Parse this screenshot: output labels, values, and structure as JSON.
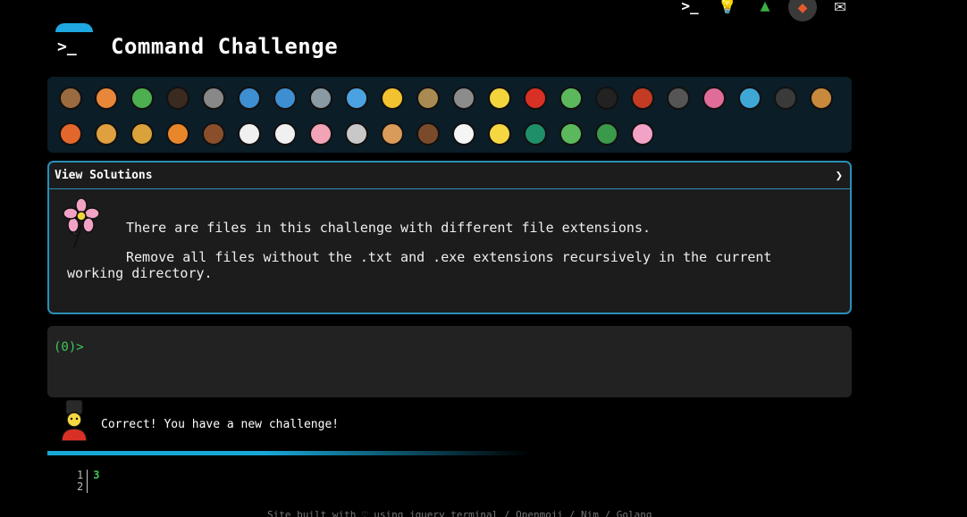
{
  "header": {
    "title": "Command Challenge",
    "logo_glyph": ">_"
  },
  "top_icons": [
    {
      "icon": "terminal-icon",
      "glyph": ">_"
    },
    {
      "icon": "lightbulb-icon",
      "glyph": "💡"
    },
    {
      "icon": "tree-icon",
      "glyph": "▲"
    },
    {
      "icon": "shield-icon",
      "glyph": "◆"
    },
    {
      "icon": "mail-icon",
      "glyph": "✉"
    }
  ],
  "emojis": {
    "row1": [
      {
        "name": "snail",
        "color": "#9a6b3f"
      },
      {
        "name": "butterfly",
        "color": "#e8873a"
      },
      {
        "name": "caterpillar",
        "color": "#4caf50"
      },
      {
        "name": "ant",
        "color": "#3a2a20"
      },
      {
        "name": "spider-web",
        "color": "#888888"
      },
      {
        "name": "whale",
        "color": "#3d8fd1"
      },
      {
        "name": "dolphin",
        "color": "#3d8fd1"
      },
      {
        "name": "shark",
        "color": "#8a9aa3"
      },
      {
        "name": "fish",
        "color": "#4aa3e0"
      },
      {
        "name": "tropical-fish",
        "color": "#f2c230"
      },
      {
        "name": "blowfish",
        "color": "#a88a52"
      },
      {
        "name": "wolf",
        "color": "#8c8c8c"
      },
      {
        "name": "bee",
        "color": "#f2d53c"
      },
      {
        "name": "ladybug",
        "color": "#d93025"
      },
      {
        "name": "cricket",
        "color": "#5cb85c"
      },
      {
        "name": "spider",
        "color": "#222222"
      },
      {
        "name": "scorpion",
        "color": "#c23b22"
      },
      {
        "name": "fly",
        "color": "#555555"
      },
      {
        "name": "worm",
        "color": "#e06c9a"
      },
      {
        "name": "microbe",
        "color": "#3fa7d6"
      },
      {
        "name": "gorilla",
        "color": "#3a3a3a"
      },
      {
        "name": "dog",
        "color": "#c8893d"
      }
    ],
    "row2": [
      {
        "name": "fox",
        "color": "#e2672d"
      },
      {
        "name": "cat",
        "color": "#e0a040"
      },
      {
        "name": "lion",
        "color": "#d9a23a"
      },
      {
        "name": "tiger",
        "color": "#e8872a"
      },
      {
        "name": "horse",
        "color": "#8a4e2b"
      },
      {
        "name": "unicorn",
        "color": "#f0f0f0"
      },
      {
        "name": "cow",
        "color": "#f0f0f0"
      },
      {
        "name": "pig",
        "color": "#f2a3b5"
      },
      {
        "name": "mouse",
        "color": "#c8c8c8"
      },
      {
        "name": "hamster",
        "color": "#d99b5a"
      },
      {
        "name": "bear",
        "color": "#7a4b2a"
      },
      {
        "name": "panda",
        "color": "#f5f5f5"
      },
      {
        "name": "chick",
        "color": "#f5d742"
      },
      {
        "name": "peacock",
        "color": "#1f8f6a"
      },
      {
        "name": "frog",
        "color": "#5cb85c"
      },
      {
        "name": "dragon",
        "color": "#3a9a4a"
      },
      {
        "name": "blossom",
        "color": "#f2a3c5"
      }
    ]
  },
  "solutions_panel": {
    "header_label": "View Solutions",
    "chevron": "❯",
    "paragraph1": "There are files in this challenge with different file extensions.",
    "paragraph2": "Remove all files without the .txt and .exe extensions recursively in the current working directory."
  },
  "terminal": {
    "prompt": "(0)>"
  },
  "status_message": "Correct! You have a new challenge!",
  "editor": {
    "line_numbers": [
      "1",
      "2"
    ],
    "line1": "3"
  },
  "footer": {
    "text": "Site built with ♡ using jquery terminal / Openmoji / Nim / Golang"
  },
  "colors": {
    "accent": "#1ea7e0",
    "prompt_green": "#3ec95a",
    "panel_bg": "#1c1c1c"
  }
}
